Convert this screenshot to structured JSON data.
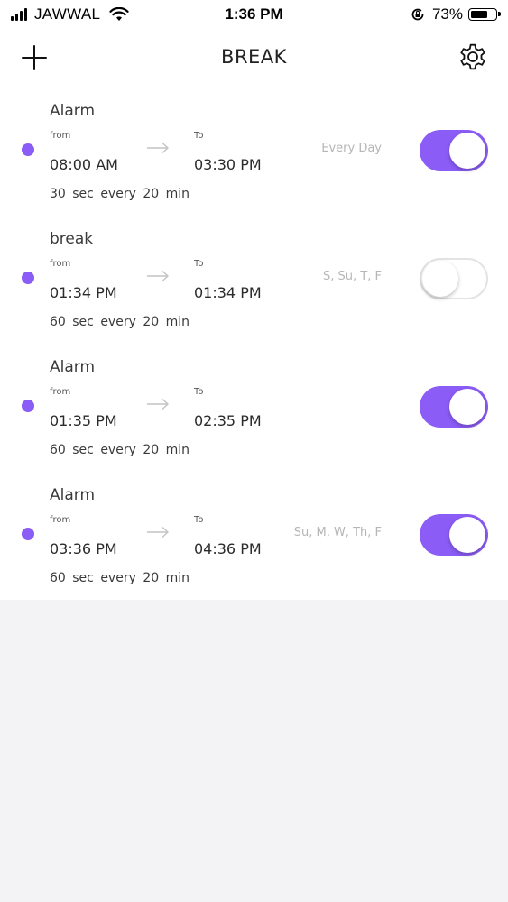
{
  "status_bar": {
    "carrier": "JAWWAL",
    "time": "1:36 PM",
    "battery_percent": "73%",
    "battery_level": 0.73
  },
  "nav": {
    "title": "BREAK",
    "add_icon": "plus-icon",
    "settings_icon": "gear-icon"
  },
  "colors": {
    "accent": "#8b5cf6",
    "background": "#f3f2f5"
  },
  "alarms": [
    {
      "name": "Alarm",
      "from_label": "from",
      "from_time": "08:00 AM",
      "to_label": "To",
      "to_time": "03:30 PM",
      "days": "Every Day",
      "duration": "30 sec every 20 min",
      "enabled": true
    },
    {
      "name": "break",
      "from_label": "from",
      "from_time": "01:34 PM",
      "to_label": "To",
      "to_time": "01:34 PM",
      "days": "S, Su, T, F",
      "duration": "60 sec every 20 min",
      "enabled": false
    },
    {
      "name": "Alarm",
      "from_label": "from",
      "from_time": "01:35 PM",
      "to_label": "To",
      "to_time": "02:35 PM",
      "days": "",
      "duration": "60 sec every 20 min",
      "enabled": true
    },
    {
      "name": "Alarm",
      "from_label": "from",
      "from_time": "03:36 PM",
      "to_label": "To",
      "to_time": "04:36 PM",
      "days": "Su, M, W, Th, F",
      "duration": "60 sec every 20 min",
      "enabled": true
    }
  ]
}
